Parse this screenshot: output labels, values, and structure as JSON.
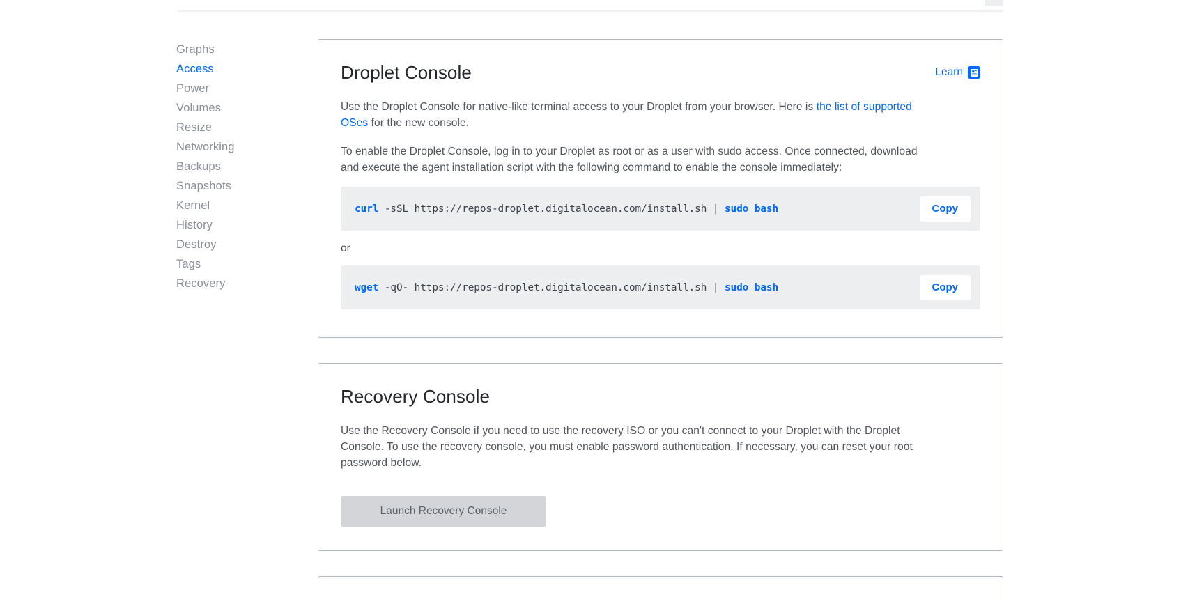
{
  "subnav": {
    "items": [
      {
        "label": "Graphs",
        "active": false
      },
      {
        "label": "Access",
        "active": true
      },
      {
        "label": "Power",
        "active": false
      },
      {
        "label": "Volumes",
        "active": false
      },
      {
        "label": "Resize",
        "active": false
      },
      {
        "label": "Networking",
        "active": false
      },
      {
        "label": "Backups",
        "active": false
      },
      {
        "label": "Snapshots",
        "active": false
      },
      {
        "label": "Kernel",
        "active": false
      },
      {
        "label": "History",
        "active": false
      },
      {
        "label": "Destroy",
        "active": false
      },
      {
        "label": "Tags",
        "active": false
      },
      {
        "label": "Recovery",
        "active": false
      }
    ]
  },
  "droplet_console": {
    "title": "Droplet Console",
    "learn_label": "Learn",
    "learn_icon": "article-doc-icon",
    "intro_before_link": "Use the Droplet Console for native-like terminal access to your Droplet from your browser. Here is ",
    "intro_link": "the list of supported OSes",
    "intro_after_link": " for the new console.",
    "instructions": "To enable the Droplet Console, log in to your Droplet as root or as a user with sudo access. Once connected, download and execute the agent installation script with the following command to enable the console immediately:",
    "or_label": "or",
    "commands": [
      {
        "copy_label": "Copy",
        "tokens": [
          {
            "text": "curl",
            "kw": true
          },
          {
            "text": " -sSL https://repos-droplet.digitalocean.com/install.sh | ",
            "kw": false
          },
          {
            "text": "sudo bash",
            "kw": true
          }
        ]
      },
      {
        "copy_label": "Copy",
        "tokens": [
          {
            "text": "wget",
            "kw": true
          },
          {
            "text": " -qO- https://repos-droplet.digitalocean.com/install.sh | ",
            "kw": false
          },
          {
            "text": "sudo bash",
            "kw": true
          }
        ]
      }
    ]
  },
  "recovery_console": {
    "title": "Recovery Console",
    "description": "Use the Recovery Console if you need to use the recovery ISO or you can't connect to your Droplet with the Droplet Console. To use the recovery console, you must enable password authentication. If necessary, you can reset your root password below.",
    "launch_label": "Launch Recovery Console"
  },
  "colors": {
    "accent": "#0069ff",
    "body_text": "#50555c",
    "heading": "#23262c",
    "muted_nav": "#8a8f98",
    "card_border": "#b0b7c3",
    "code_bg": "#eceeef",
    "disabled_btn_bg": "#d3d5d8"
  }
}
